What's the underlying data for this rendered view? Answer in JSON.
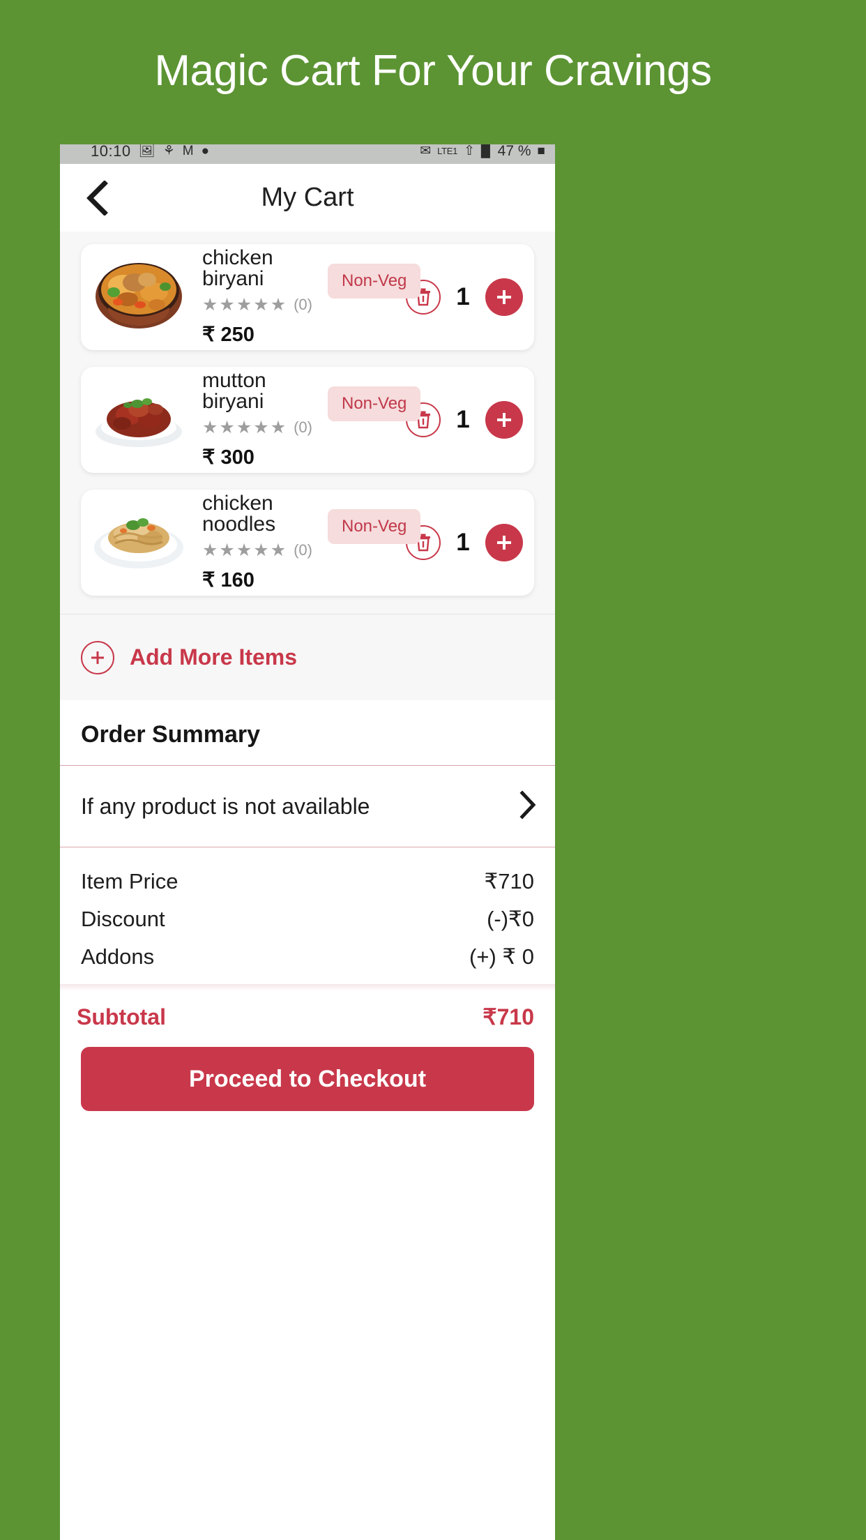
{
  "promo": {
    "headline": "Magic Cart For Your Cravings"
  },
  "statusbar": {
    "time": "10:10",
    "icons_left": [
      "photo-icon",
      "blossom-icon",
      "gmail-icon",
      "dot-icon"
    ],
    "network": "LTE1",
    "icons_right": [
      "message-icon",
      "vpn-icon",
      "signal-icon",
      "battery-icon"
    ],
    "battery": "47 %"
  },
  "appbar": {
    "title": "My Cart",
    "back_icon": "chevron-left-icon"
  },
  "cart": {
    "items": [
      {
        "name": "chicken biryani",
        "badge": "Non-Veg",
        "rating_count": "(0)",
        "stars": 5,
        "price": "₹ 250",
        "qty": "1",
        "image": "chicken-biryani-bowl"
      },
      {
        "name": "mutton biryani",
        "badge": "Non-Veg",
        "rating_count": "(0)",
        "stars": 5,
        "price": "₹ 300",
        "qty": "1",
        "image": "mutton-curry-plate"
      },
      {
        "name": "chicken noodles",
        "badge": "Non-Veg",
        "rating_count": "(0)",
        "stars": 5,
        "price": "₹ 160",
        "qty": "1",
        "image": "chicken-noodles-plate"
      }
    ],
    "add_more_label": "Add More Items"
  },
  "summary": {
    "title": "Order Summary",
    "not_available_label": "If any product is not available",
    "rows": [
      {
        "label": "Item Price",
        "value": "₹710"
      },
      {
        "label": "Discount",
        "value": "(-)₹0"
      },
      {
        "label": "Addons",
        "value": "(+) ₹ 0"
      }
    ],
    "subtotal_label": "Subtotal",
    "subtotal_value": "₹710",
    "checkout_label": "Proceed to Checkout"
  },
  "colors": {
    "brand_green": "#5c9433",
    "accent_red": "#c8384a",
    "badge_bg": "#f6dcdc",
    "badge_text": "#c0384a"
  }
}
